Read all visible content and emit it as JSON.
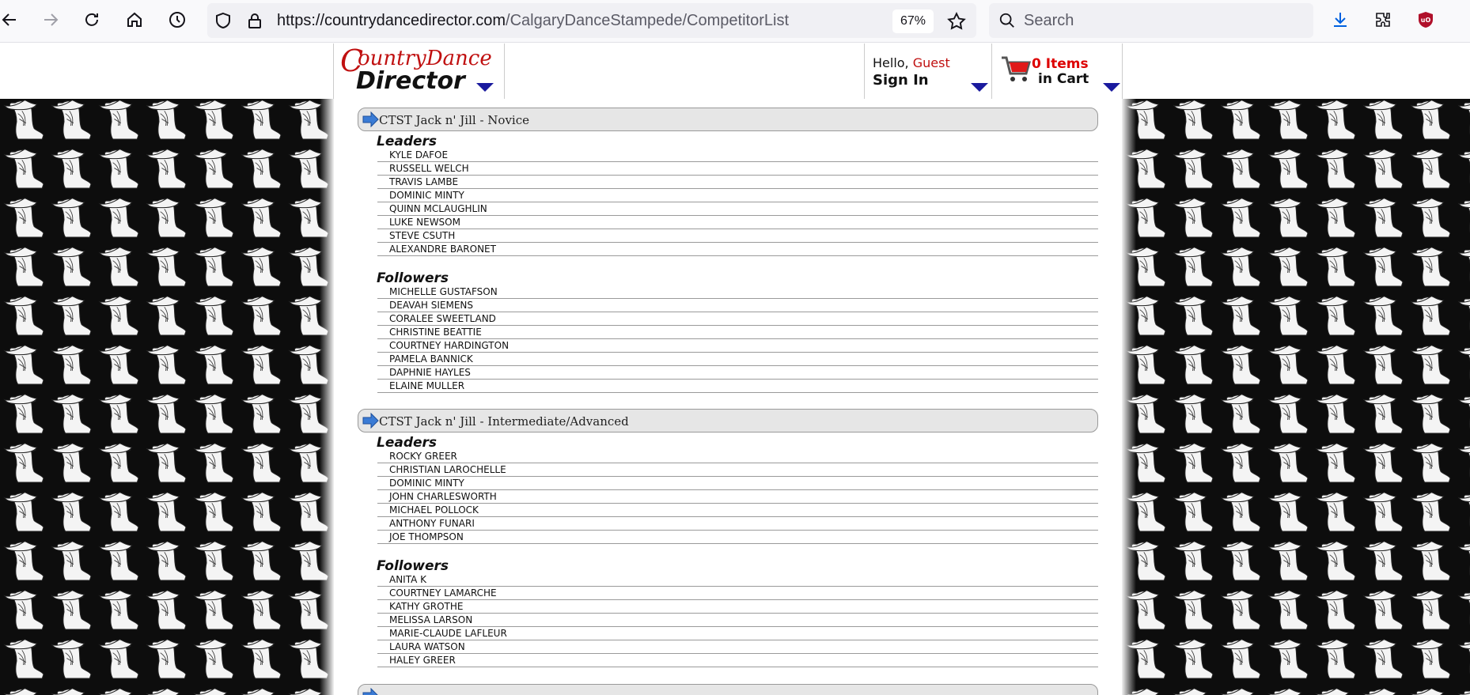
{
  "browser": {
    "url_domain": "https://countrydancedirector.com",
    "url_path": "/CalgaryDanceStampede/CompetitorList",
    "zoom": "67%",
    "search_placeholder": "Search",
    "colors": {
      "toolbar": "#f9f9fb",
      "urlbar": "#f0f0f4",
      "ublock": "#b0102a",
      "download": "#0061e0"
    }
  },
  "header": {
    "logo_line1": "ountryDance",
    "logo_initial": "C",
    "logo_line2": "Director",
    "hello": "Hello,",
    "guest": "Guest",
    "sign_in": "Sign In",
    "cart_count": "0 Items",
    "cart_label": "in Cart"
  },
  "events": [
    {
      "title": "CTST Jack n' Jill - Novice",
      "groups": [
        {
          "label": "Leaders",
          "names": [
            "KYLE DAFOE",
            "RUSSELL WELCH",
            "TRAVIS LAMBE",
            "DOMINIC MINTY",
            "QUINN MCLAUGHLIN",
            "LUKE NEWSOM",
            "STEVE CSUTH",
            "ALEXANDRE BARONET"
          ]
        },
        {
          "label": "Followers",
          "names": [
            "MICHELLE GUSTAFSON",
            "DEAVAH SIEMENS",
            "CORALEE SWEETLAND",
            "CHRISTINE BEATTIE",
            "COURTNEY HARDINGTON",
            "PAMELA BANNICK",
            "DAPHNIE HAYLES",
            "ELAINE MULLER"
          ]
        }
      ]
    },
    {
      "title": "CTST Jack n' Jill - Intermediate/Advanced",
      "groups": [
        {
          "label": "Leaders",
          "names": [
            "ROCKY GREER",
            "CHRISTIAN LAROCHELLE",
            "DOMINIC MINTY",
            "JOHN CHARLESWORTH",
            "MICHAEL POLLOCK",
            "ANTHONY FUNARI",
            "JOE THOMPSON"
          ]
        },
        {
          "label": "Followers",
          "names": [
            "ANITA K",
            "COURTNEY LAMARCHE",
            "KATHY GROTHE",
            "MELISSA LARSON",
            "MARIE-CLAUDE LAFLEUR",
            "LAURA WATSON",
            "HALEY GREER"
          ]
        }
      ]
    },
    {
      "title": "",
      "groups": []
    }
  ]
}
